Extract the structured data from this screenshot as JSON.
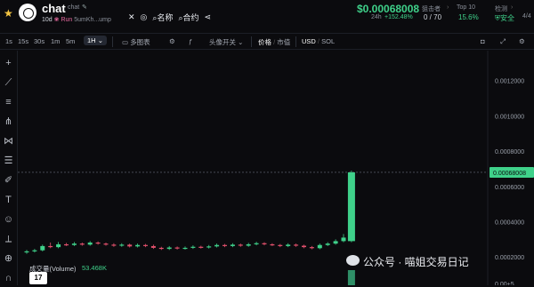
{
  "header": {
    "title": "chat",
    "subtitle": "chat",
    "age": "10d",
    "run_label": "Run",
    "address": "5umKh...ump",
    "menu": {
      "name_label": "名称",
      "contract_label": "合约"
    }
  },
  "price": {
    "value": "$0.00068008",
    "period": "24h",
    "change": "+152.48%"
  },
  "stats": {
    "holders_label": "狙击者",
    "holders_value": "0 / 70",
    "top10_label": "Top 10",
    "top10_value": "15.6%",
    "check_label": "检测",
    "check_value": "安全",
    "check_count": "4/4"
  },
  "toolbar": {
    "intervals": [
      "1s",
      "15s",
      "30s",
      "1m",
      "5m",
      "1H"
    ],
    "active_interval": "1H",
    "indicators_label": "多图表",
    "avatar_toggle_label": "头像开关",
    "price_label": "价格",
    "mcap_label": "市值",
    "currency_usd": "USD",
    "currency_sol": "SOL"
  },
  "volume": {
    "label": "成交量(Volume)",
    "value": "53.468K"
  },
  "watermark": "公众号 · 喵姐交易日记",
  "tv_logo": "17",
  "colors": {
    "up": "#3fd18a",
    "down": "#e2506c",
    "accent": "#3fd18a",
    "safe": "#3fd18a"
  },
  "chart_data": {
    "type": "candlestick",
    "y_ticks": [
      "0.0012000",
      "0.0010000",
      "0.0008000",
      "0.0006000",
      "0.0004000",
      "0.0002000",
      "0.00+5"
    ],
    "last_price_label": "0.00068008",
    "ylim": [
      4e-05,
      0.00137
    ],
    "candles": [
      {
        "o": 0.000226,
        "c": 0.000232,
        "h": 0.00024,
        "l": 0.000218
      },
      {
        "o": 0.000232,
        "c": 0.000238,
        "h": 0.000246,
        "l": 0.000226
      },
      {
        "o": 0.000238,
        "c": 0.000262,
        "h": 0.00027,
        "l": 0.000232
      },
      {
        "o": 0.000262,
        "c": 0.000256,
        "h": 0.000282,
        "l": 0.00025
      },
      {
        "o": 0.000256,
        "c": 0.000272,
        "h": 0.000285,
        "l": 0.00025
      },
      {
        "o": 0.000272,
        "c": 0.000268,
        "h": 0.00028,
        "l": 0.000262
      },
      {
        "o": 0.000268,
        "c": 0.000276,
        "h": 0.000285,
        "l": 0.000262
      },
      {
        "o": 0.000276,
        "c": 0.00027,
        "h": 0.000282,
        "l": 0.000264
      },
      {
        "o": 0.00027,
        "c": 0.000282,
        "h": 0.00029,
        "l": 0.000264
      },
      {
        "o": 0.000282,
        "c": 0.000276,
        "h": 0.000288,
        "l": 0.00027
      },
      {
        "o": 0.000276,
        "c": 0.00027,
        "h": 0.000282,
        "l": 0.000264
      },
      {
        "o": 0.00027,
        "c": 0.000264,
        "h": 0.000278,
        "l": 0.000258
      },
      {
        "o": 0.000264,
        "c": 0.00027,
        "h": 0.000278,
        "l": 0.000258
      },
      {
        "o": 0.00027,
        "c": 0.00026,
        "h": 0.000276,
        "l": 0.000254
      },
      {
        "o": 0.00026,
        "c": 0.000268,
        "h": 0.000276,
        "l": 0.000254
      },
      {
        "o": 0.000268,
        "c": 0.000262,
        "h": 0.000274,
        "l": 0.000256
      },
      {
        "o": 0.000262,
        "c": 0.000252,
        "h": 0.00027,
        "l": 0.000246
      },
      {
        "o": 0.000252,
        "c": 0.000246,
        "h": 0.000258,
        "l": 0.00024
      },
      {
        "o": 0.000246,
        "c": 0.000254,
        "h": 0.000262,
        "l": 0.00024
      },
      {
        "o": 0.000254,
        "c": 0.000248,
        "h": 0.00026,
        "l": 0.000242
      },
      {
        "o": 0.000248,
        "c": 0.000252,
        "h": 0.00026,
        "l": 0.000242
      },
      {
        "o": 0.000252,
        "c": 0.000258,
        "h": 0.000266,
        "l": 0.000246
      },
      {
        "o": 0.000258,
        "c": 0.000254,
        "h": 0.000264,
        "l": 0.000248
      },
      {
        "o": 0.000254,
        "c": 0.00026,
        "h": 0.000268,
        "l": 0.000248
      },
      {
        "o": 0.00026,
        "c": 0.000268,
        "h": 0.000276,
        "l": 0.000254
      },
      {
        "o": 0.000268,
        "c": 0.000262,
        "h": 0.000274,
        "l": 0.000256
      },
      {
        "o": 0.000262,
        "c": 0.00027,
        "h": 0.000278,
        "l": 0.000256
      },
      {
        "o": 0.00027,
        "c": 0.000264,
        "h": 0.000276,
        "l": 0.000258
      },
      {
        "o": 0.000264,
        "c": 0.000272,
        "h": 0.00028,
        "l": 0.000258
      },
      {
        "o": 0.000272,
        "c": 0.000278,
        "h": 0.000286,
        "l": 0.000266
      },
      {
        "o": 0.000278,
        "c": 0.000272,
        "h": 0.000284,
        "l": 0.000266
      },
      {
        "o": 0.000272,
        "c": 0.000268,
        "h": 0.000278,
        "l": 0.000262
      },
      {
        "o": 0.000268,
        "c": 0.000262,
        "h": 0.000274,
        "l": 0.000256
      },
      {
        "o": 0.000262,
        "c": 0.00027,
        "h": 0.000278,
        "l": 0.000256
      },
      {
        "o": 0.00027,
        "c": 0.000264,
        "h": 0.000276,
        "l": 0.000258
      },
      {
        "o": 0.000264,
        "c": 0.000256,
        "h": 0.00027,
        "l": 0.00025
      },
      {
        "o": 0.000256,
        "c": 0.00025,
        "h": 0.000262,
        "l": 0.000244
      },
      {
        "o": 0.00025,
        "c": 0.000268,
        "h": 0.000276,
        "l": 0.000244
      },
      {
        "o": 0.000268,
        "c": 0.000276,
        "h": 0.000284,
        "l": 0.000262
      },
      {
        "o": 0.000276,
        "c": 0.00029,
        "h": 0.0003,
        "l": 0.00027
      },
      {
        "o": 0.00029,
        "c": 0.00031,
        "h": 0.00033,
        "l": 0.000284
      },
      {
        "o": 0.00029,
        "c": 0.00068,
        "h": 0.00069,
        "l": 0.000284
      }
    ]
  }
}
